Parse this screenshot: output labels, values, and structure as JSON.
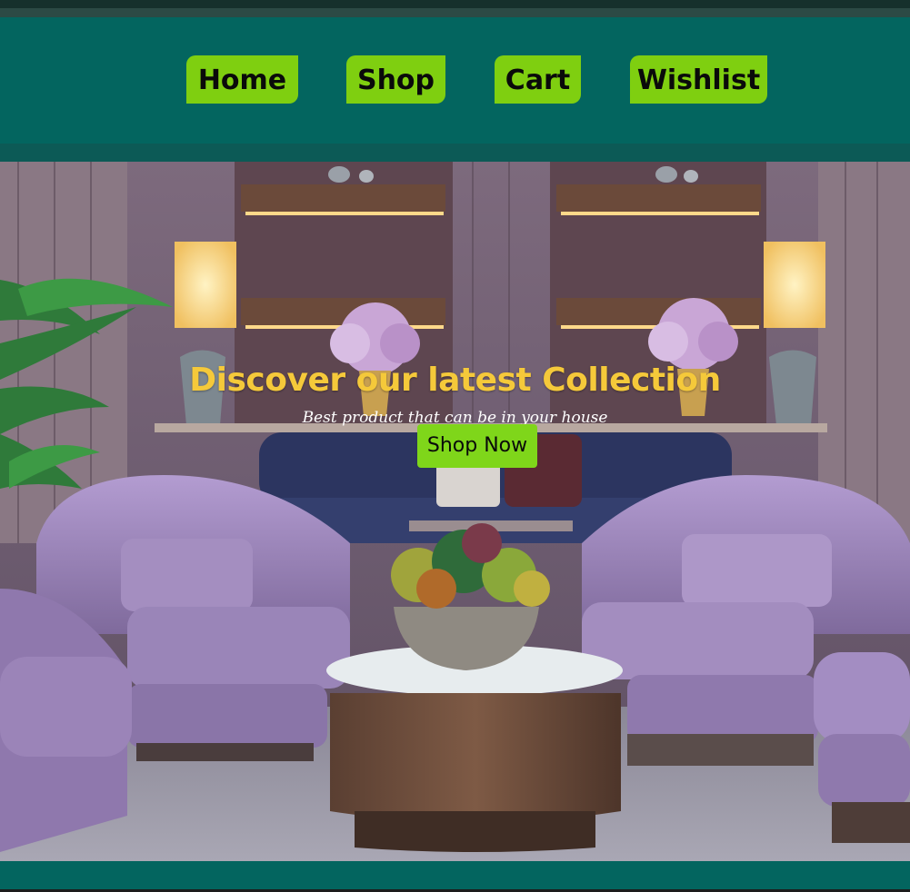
{
  "nav": {
    "items": [
      {
        "label": "Home"
      },
      {
        "label": "Shop"
      },
      {
        "label": "Cart"
      },
      {
        "label": "Wishlist"
      }
    ]
  },
  "hero": {
    "title": "Discover our latest Collection",
    "subtitle": "Best product that can be in your house",
    "cta_label": "Shop Now",
    "image_subject": "luxury lounge with lavender velvet armchairs and a round wooden coffee table"
  },
  "colors": {
    "nav_background": "#03655f",
    "nav_button": "#7fcf10",
    "title_text": "#f5c93a",
    "cta_button": "#7fd61a"
  }
}
